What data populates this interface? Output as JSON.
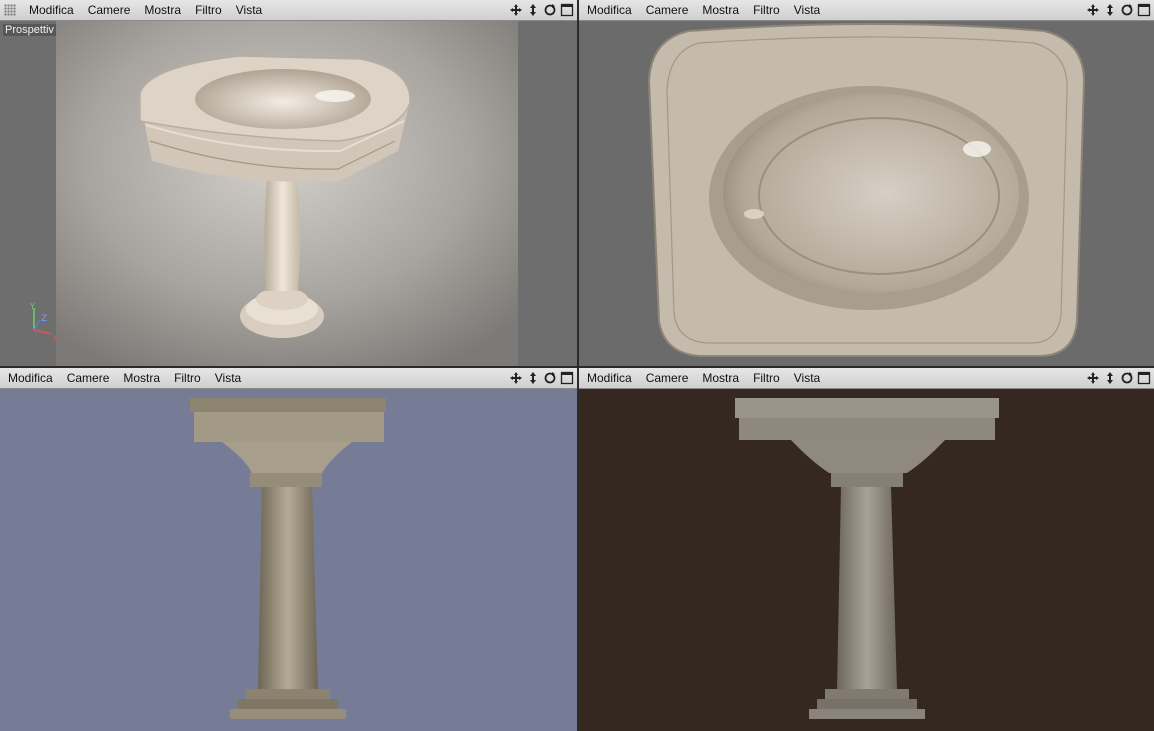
{
  "menu": [
    "Modifica",
    "Camere",
    "Mostra",
    "Filtro",
    "Vista"
  ],
  "viewports": {
    "perspective": {
      "label": "Prospettiv"
    }
  },
  "icons": {
    "move": "move-icon",
    "zoom": "zoom-arrows-icon",
    "rotate": "rotate-icon",
    "maximize": "maximize-icon"
  },
  "colors": {
    "menubar": "#d8d8d8",
    "front_bg": "#767b96",
    "side_bg": "#352820",
    "ceramic": "#cfc4b6"
  }
}
